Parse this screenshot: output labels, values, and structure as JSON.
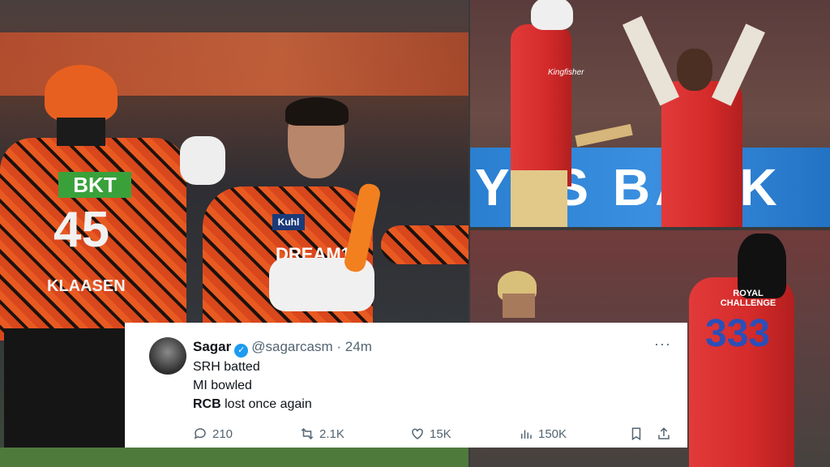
{
  "photo_left": {
    "banner_text": "",
    "player1_number": "45",
    "player1_name": "KLAASEN",
    "player1_sponsor": "BKT",
    "player2_sponsor_chest": "Kuhl",
    "player2_logo": "DREAM11"
  },
  "photo_top_right": {
    "board_text": "YES BANK",
    "jersey_text": "Kingfisher"
  },
  "photo_bottom_right": {
    "jersey_number": "333",
    "jersey_text": "ROYAL CHALLENGE"
  },
  "tweet": {
    "name": "Sagar",
    "handle": "@sagarcasm",
    "time": "24m",
    "separator": "·",
    "lines": {
      "l1": "SRH batted",
      "l2": "MI bowled",
      "l3_bold": "RCB",
      "l3_rest": "lost once again"
    },
    "actions": {
      "replies": "210",
      "reposts": "2.1K",
      "likes": "15K",
      "views": "150K"
    },
    "more": "···"
  },
  "colors": {
    "srh_orange": "#d9471c",
    "rcb_red": "#d42a2a",
    "yes_bank_blue": "#2b7fd0",
    "verified_blue": "#1d9bf0"
  }
}
